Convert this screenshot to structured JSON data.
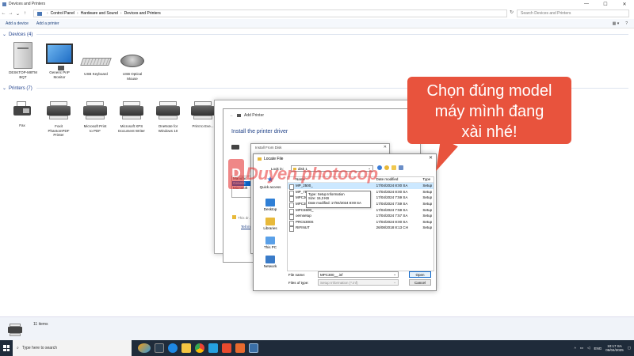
{
  "window": {
    "title": "Devices and Printers",
    "minimize": "—",
    "maximize": "☐",
    "close": "✕"
  },
  "address": {
    "crumbs": [
      "Control Panel",
      "Hardware and Sound",
      "Devices and Printers"
    ],
    "search_placeholder": "Search Devices and Printers"
  },
  "commands": {
    "add_device": "Add a device",
    "add_printer": "Add a printer"
  },
  "devices": {
    "header": "Devices (4)",
    "items": [
      {
        "label": "DESKTOP-M8TM\nBQT",
        "icon": "pc-tower-icon"
      },
      {
        "label": "Generic PnP\nMonitor",
        "icon": "monitor-icon"
      },
      {
        "label": "USB Keyboard",
        "icon": "keyboard-icon"
      },
      {
        "label": "USB Optical\nMouse",
        "icon": "mouse-icon"
      }
    ]
  },
  "printers": {
    "header": "Printers (7)",
    "items": [
      {
        "label": "Fax",
        "icon": "fax-icon"
      },
      {
        "label": "Foxit\nPhantomPDF\nPrinter",
        "icon": "printer-icon"
      },
      {
        "label": "Microsoft Print\nto PDF",
        "icon": "printer-icon"
      },
      {
        "label": "Microsoft XPS\nDocument Writer",
        "icon": "printer-icon"
      },
      {
        "label": "OneNote for\nWindows 10",
        "icon": "printer-icon"
      },
      {
        "label": "Print to Eve...",
        "icon": "printer-icon"
      }
    ]
  },
  "status": {
    "count": "11 items"
  },
  "add_printer": {
    "title": "Add Printer",
    "heading": "Install the printer driver",
    "manufacturer_items": [
      "Manufac",
      "Generic",
      "Microsoft"
    ],
    "small_text": "This dr...",
    "link": "Tell me..."
  },
  "install_disk": {
    "title": "Install From Disk"
  },
  "locate": {
    "title": "Locate File",
    "look_in_label": "Look in:",
    "look_in_value": "disk 1",
    "places": [
      "Quick access",
      "Desktop",
      "Libraries",
      "This PC",
      "Network"
    ],
    "columns": {
      "name": "Name",
      "date": "Date modified",
      "type": "Type"
    },
    "files": [
      {
        "name": "MP_2500_",
        "date": "17/04/2024 8:00 SA",
        "type": "Setup",
        "selected": true
      },
      {
        "name": "MP_7500_",
        "date": "17/04/2024 8:00 SA",
        "type": "Setup",
        "selected": false
      },
      {
        "name": "MPC3002_",
        "date": "17/04/2024 7:59 SA",
        "type": "Setup",
        "selected": false
      },
      {
        "name": "MPC3500_",
        "date": "17/04/2024 7:59 SA",
        "type": "Setup",
        "selected": false
      },
      {
        "name": "MPC6500_",
        "date": "17/04/2024 7:59 SA",
        "type": "Setup",
        "selected": false
      },
      {
        "name": "oemsetup",
        "date": "17/04/2024 7:57 SA",
        "type": "Setup",
        "selected": false
      },
      {
        "name": "PRC5300S",
        "date": "17/04/2024 8:00 SA",
        "type": "Setup",
        "selected": false
      },
      {
        "name": "RIFINUT",
        "date": "26/08/2018 8:13 CH",
        "type": "Setup",
        "selected": false
      }
    ],
    "tooltip": {
      "type": "Type: Setup Information",
      "size": "Size: 15,3 KB",
      "date": "Date modified: 17/04/2024 8:00 SA"
    },
    "file_name_label": "File name:",
    "file_name_value": "MPC300__.inf",
    "files_of_type_label": "Files of type:",
    "files_of_type_value": "Setup Information (*.inf)",
    "open": "Open",
    "cancel": "Cancel"
  },
  "watermark": {
    "badge": "D",
    "text": "Duyen photocop"
  },
  "callout": {
    "line1": "Chọn đúng model",
    "line2": "máy mình đang",
    "line3": "xài nhé!"
  },
  "taskbar": {
    "search": "Type here to search",
    "lang": "ENG",
    "time": "10:17 SA",
    "date": "05/04/2025"
  }
}
